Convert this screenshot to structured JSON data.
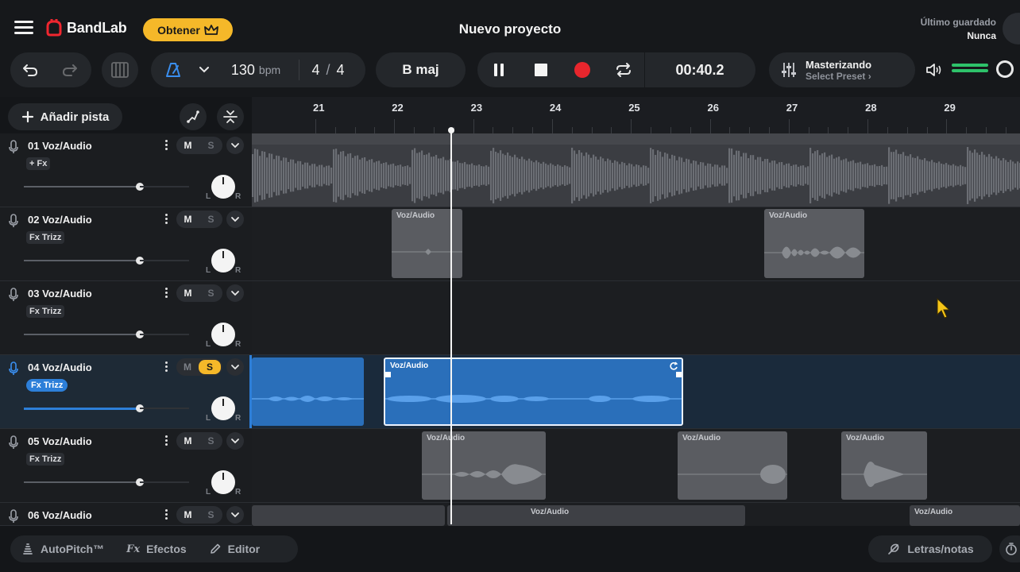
{
  "header": {
    "logo_text": "BandLab",
    "get_button": "Obtener",
    "project_title": "Nuevo proyecto",
    "save_label": "Último guardado",
    "save_value": "Nunca"
  },
  "transport": {
    "bpm_value": "130",
    "bpm_unit": "bpm",
    "time_sig_num": "4",
    "time_sig_sep": "/",
    "time_sig_den": "4",
    "key": "B maj",
    "time": "00:40.2",
    "mastering_title": "Masterizando",
    "mastering_sub": "Select Preset ›",
    "record_color": "#e8262d",
    "accent_color": "#f5b829"
  },
  "toolbar": {
    "add_track": "Añadir pista"
  },
  "ruler": {
    "bars": [
      "21",
      "22",
      "23",
      "24",
      "25",
      "26",
      "27",
      "28",
      "29"
    ]
  },
  "tracks": [
    {
      "name": "01 Voz/Audio",
      "fx": "+ Fx",
      "mute": "M",
      "solo": "S",
      "pan_l": "L",
      "pan_r": "R",
      "volume": 0.7
    },
    {
      "name": "02 Voz/Audio",
      "fx": "Fx Trizz",
      "mute": "M",
      "solo": "S",
      "pan_l": "L",
      "pan_r": "R",
      "volume": 0.7
    },
    {
      "name": "03 Voz/Audio",
      "fx": "Fx Trizz",
      "mute": "M",
      "solo": "S",
      "pan_l": "L",
      "pan_r": "R",
      "volume": 0.7
    },
    {
      "name": "04 Voz/Audio",
      "fx": "Fx Trizz",
      "mute": "M",
      "solo": "S",
      "pan_l": "L",
      "pan_r": "R",
      "volume": 0.7,
      "selected": true,
      "solo_on": true
    },
    {
      "name": "05 Voz/Audio",
      "fx": "Fx Trizz",
      "mute": "M",
      "solo": "S",
      "pan_l": "L",
      "pan_r": "R",
      "volume": 0.7
    },
    {
      "name": "06 Voz/Audio",
      "mute": "M",
      "solo": "S"
    }
  ],
  "clips": {
    "label": "Voz/Audio"
  },
  "bottom": {
    "autopitch": "AutoPitch™",
    "fx_mark": "Fx",
    "effects": "Efectos",
    "editor": "Editor",
    "lyrics": "Letras/notas"
  }
}
